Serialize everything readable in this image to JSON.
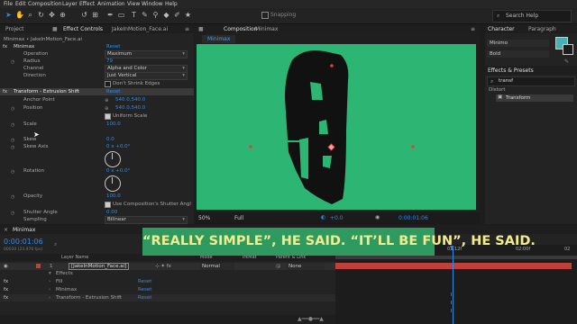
{
  "menu": [
    "File",
    "Edit",
    "Composition",
    "Layer",
    "Effect",
    "Animation",
    "View",
    "Window",
    "Help"
  ],
  "toolbar": {
    "snapping_label": "Snapping",
    "search_placeholder": "Search Help"
  },
  "left_panel": {
    "tabs": {
      "project": "Project",
      "effect_controls": "Effect Controls",
      "effect_controls_target": "JakeInMotion_Face.ai"
    },
    "breadcrumb": "Minimax • JakeInMotion_Face.ai",
    "minimax": {
      "name": "Minimax",
      "reset": "Reset",
      "operation_label": "Operation",
      "operation_value": "Maximum",
      "radius_label": "Radius",
      "radius_value": "79",
      "channel_label": "Channel",
      "channel_value": "Alpha and Color",
      "direction_label": "Direction",
      "direction_value": "Just Vertical",
      "shrink_label": "Don't Shrink Edges"
    },
    "transform": {
      "name": "Transform - Extrusion Shift",
      "reset": "Reset",
      "anchor_label": "Anchor Point",
      "anchor_value": "540.0,540.0",
      "position_label": "Position",
      "position_value": "540.0,540.0",
      "uniform_label": "Uniform Scale",
      "scale_label": "Scale",
      "scale_value": "100.0",
      "skew_label": "Skew",
      "skew_value": "0.0",
      "skew_axis_label": "Skew Axis",
      "skew_axis_value": "0 x +0.0°",
      "rotation_label": "Rotation",
      "rotation_value": "0 x +0.0°",
      "opacity_label": "Opacity",
      "opacity_value": "100.0",
      "shutter_label": "Use Composition's Shutter Angl",
      "shutter_angle_label": "Shutter Angle",
      "shutter_angle_value": "0.00",
      "sampling_label": "Sampling",
      "sampling_value": "Bilinear"
    }
  },
  "comp_panel": {
    "tab_label": "Composition",
    "tab_name": "Minimax",
    "subtab": "Minimax",
    "zoom": "50%",
    "resolution": "Full",
    "exposure": "+0.0",
    "timecode": "0:00:01:06"
  },
  "right_panel": {
    "character_tab": "Character",
    "paragraph_tab": "Paragraph",
    "font_family": "Minimo",
    "font_style": "Bold",
    "effects_tab": "Effects & Presets",
    "effects_search": "transf",
    "distort_category": "Distort",
    "transform_effect": "Transform"
  },
  "caption": "“REALLY SIMPLE”, HE SAID. “IT’LL BE FUN”, HE SAID.",
  "timeline": {
    "tab": "Minimax",
    "timecode": "0:00:01:06",
    "frame_info": "00030 (23.976 fps)",
    "columns": {
      "layer_name": "Layer Name",
      "mode": "Mode",
      "trkmat": "TrkMat",
      "parent": "Parent & Link"
    },
    "layer": {
      "index": "1",
      "name": "[JakeInMotion_Face.ai]",
      "mode": "Normal",
      "parent": "None"
    },
    "effects_label": "Effects",
    "effects": [
      {
        "name": "Fill",
        "reset": "Reset"
      },
      {
        "name": "Minimax",
        "reset": "Reset"
      },
      {
        "name": "Transform - Extrusion Shift",
        "reset": "Reset"
      }
    ],
    "ruler": [
      "01:12f",
      "02:00f",
      "02"
    ]
  },
  "colors": {
    "comp_bg": "#2cb573",
    "accent": "#2d8ceb",
    "caption_bg": "#2f9a5f",
    "caption_text": "#f3ec8e",
    "track_red": "#c0413b"
  }
}
